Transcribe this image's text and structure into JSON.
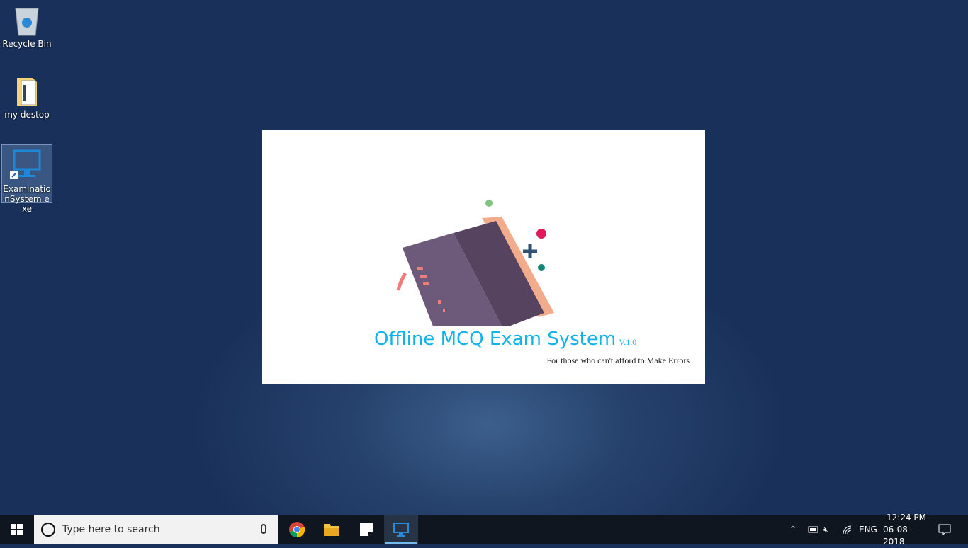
{
  "desktop": {
    "icons": [
      {
        "label": "Recycle Bin",
        "icon": "recycle-bin-icon"
      },
      {
        "label": "my destop",
        "icon": "folder-icon"
      },
      {
        "label": "ExaminationSystem.exe",
        "icon": "monitor-app-icon",
        "selected": true
      }
    ]
  },
  "splash": {
    "title": "Offline MCQ Exam System",
    "version": "V.1.0",
    "tagline": "For  those who can't afford to Make Errors",
    "accent": "#12b3ec"
  },
  "taskbar": {
    "search_placeholder": "Type here to search",
    "apps": [
      "chrome-icon",
      "file-explorer-icon",
      "sticky-notes-icon",
      "examination-system-icon"
    ],
    "tray": {
      "language": "ENG",
      "time": "12:24 PM",
      "date": "06-08-2018"
    }
  }
}
